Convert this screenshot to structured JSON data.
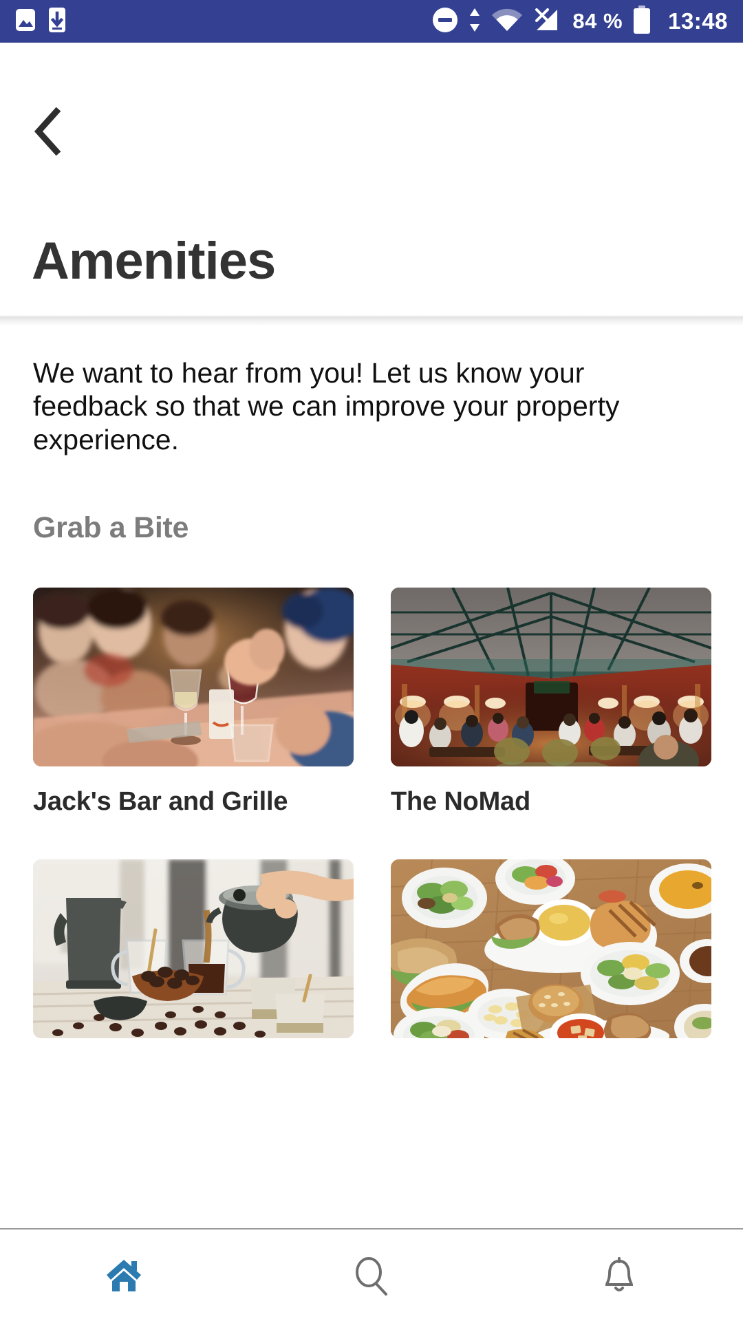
{
  "status_bar": {
    "background_color": "#344192",
    "left_icons": [
      {
        "name": "image-icon",
        "label": "image"
      },
      {
        "name": "download-to-phone-icon",
        "label": "download"
      }
    ],
    "right_icons": [
      {
        "name": "do-not-disturb-icon",
        "label": "do not disturb"
      },
      {
        "name": "data-transfer-icon",
        "label": "data transfer"
      },
      {
        "name": "wifi-icon",
        "label": "wifi"
      },
      {
        "name": "cellular-signal-off-icon",
        "label": "no signal"
      },
      {
        "name": "battery-icon",
        "label": "battery"
      }
    ],
    "battery_percent": "84 %",
    "time": "13:48"
  },
  "header": {
    "back_label": "Back",
    "title": "Amenities"
  },
  "main": {
    "intro": "We want to hear from you! Let us know your feedback so that we can improve your property experience.",
    "section_title": "Grab a Bite",
    "cards": [
      {
        "label": "Jack's Bar and Grille",
        "image": "restaurant-people-wine-scene"
      },
      {
        "label": "The NoMad",
        "image": "atrium-restaurant-glass-roof-scene"
      },
      {
        "label": "",
        "image": "coffee-pouring-scene"
      },
      {
        "label": "",
        "image": "food-spread-overhead-scene"
      }
    ]
  },
  "bottom_nav": {
    "active_color": "#2b7bb0",
    "inactive_color": "#6e6e6e",
    "items": [
      {
        "name": "home",
        "label": "Home",
        "active": true
      },
      {
        "name": "search",
        "label": "Search",
        "active": false
      },
      {
        "name": "notifications",
        "label": "Notifications",
        "active": false
      }
    ]
  }
}
